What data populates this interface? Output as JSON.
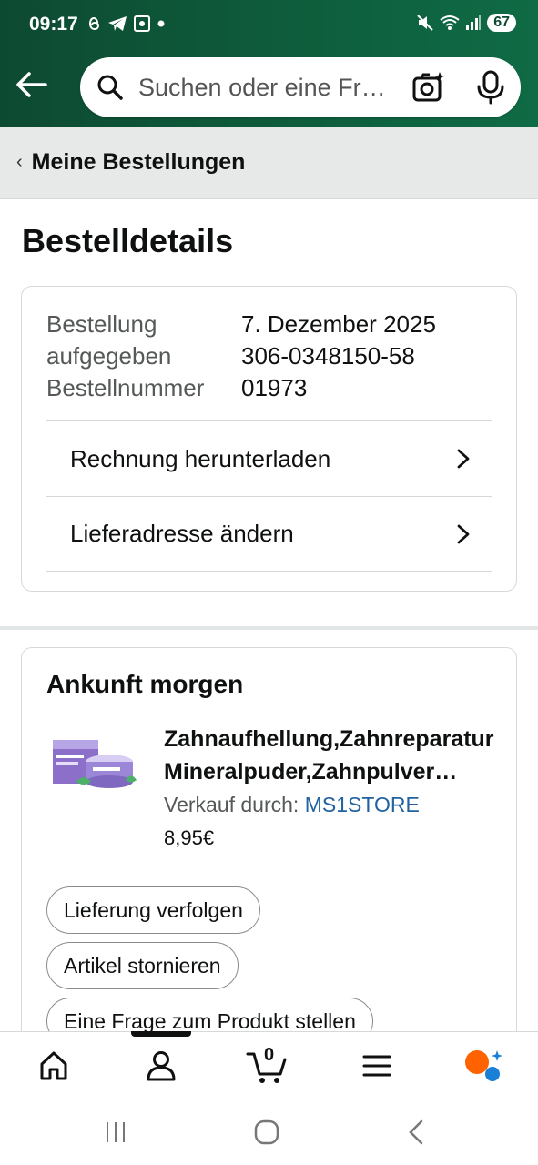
{
  "status_bar": {
    "time": "09:17",
    "battery": "67"
  },
  "search": {
    "placeholder": "Suchen oder eine Fr…"
  },
  "breadcrumb": {
    "label": "Meine Bestellungen"
  },
  "page_title": "Bestelldetails",
  "order": {
    "placed_label": "Bestellung aufgegeben",
    "placed_value": "7. Dezember 2025",
    "number_label": "Bestellnummer",
    "number_value": "306-0348150-5801973",
    "actions": [
      {
        "label": "Rechnung herunterladen"
      },
      {
        "label": "Lieferadresse ändern"
      }
    ]
  },
  "shipment": {
    "heading": "Ankunft morgen",
    "product": {
      "name_line1": "Zahnaufhellung,Zahnreparatur",
      "name_line2": "Mineralpuder,Zahnpulver…",
      "seller_prefix": "Verkauf durch:",
      "seller_name": "MS1STORE",
      "price": "8,95€"
    },
    "buttons": [
      {
        "label": "Lieferung verfolgen"
      },
      {
        "label": "Artikel stornieren"
      },
      {
        "label": "Eine Frage zum Produkt stellen"
      }
    ]
  },
  "bottom_nav": {
    "cart_count": "0",
    "items": [
      "home-icon",
      "account-icon",
      "cart-icon",
      "menu-icon",
      "rufus-icon"
    ]
  },
  "colors": {
    "header": "#0e5d3c",
    "link": "#2162a1",
    "breadcrumb_bg": "#e7e9e9"
  }
}
